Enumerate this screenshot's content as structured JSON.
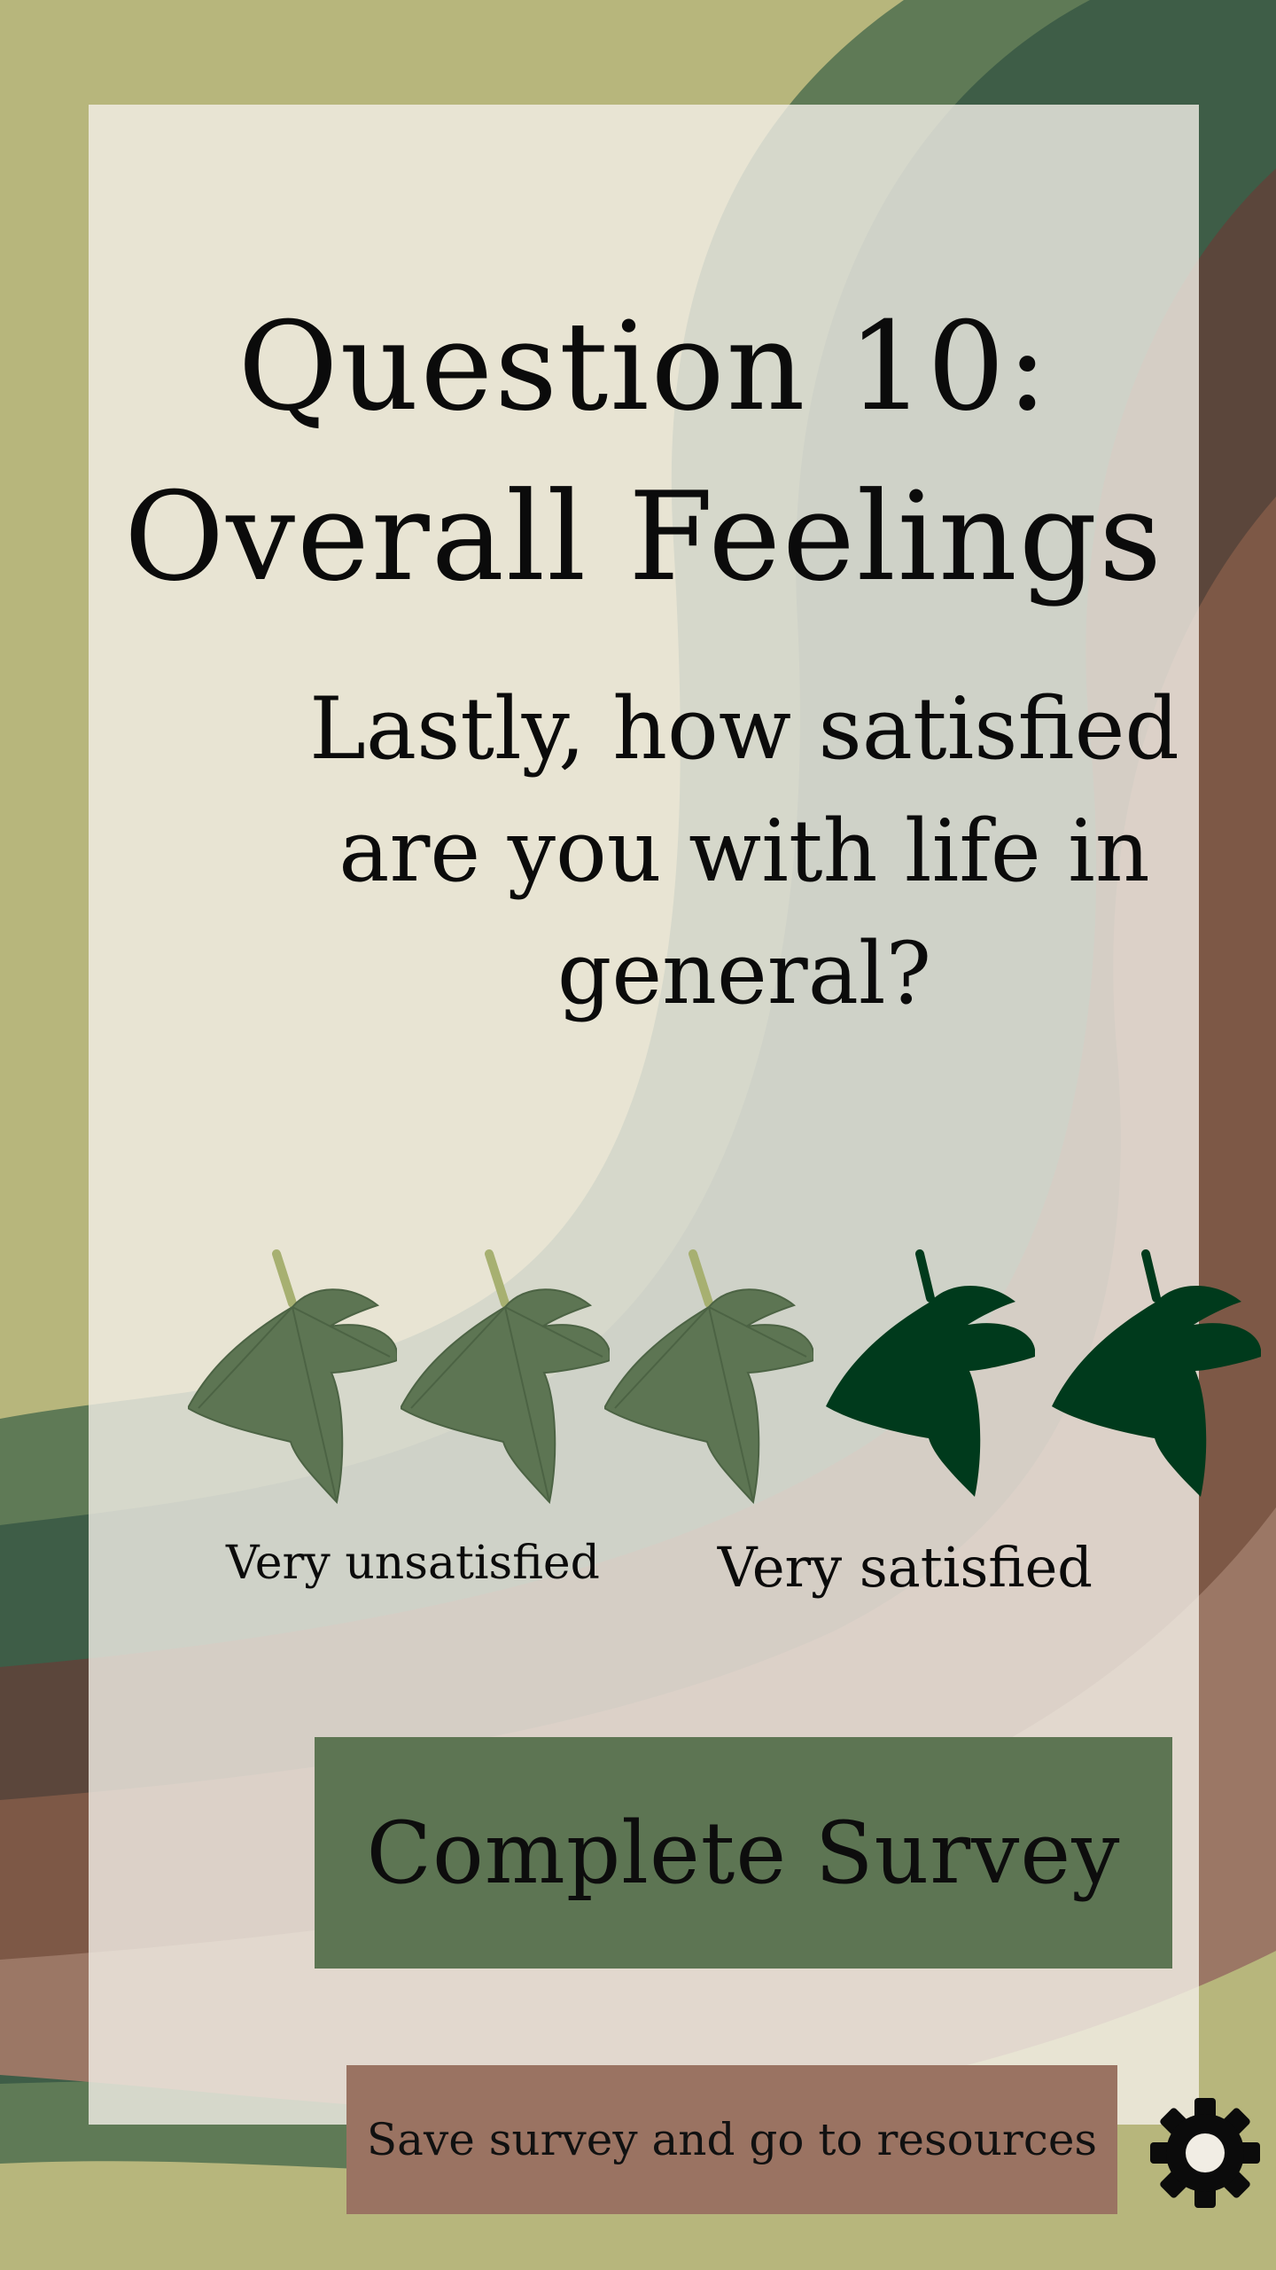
{
  "screen": {
    "title": "Question 10:\nOverall Feelings",
    "question": "Lastly, how satisfied are you with life in general?"
  },
  "rating": {
    "max": 5,
    "selected": 3,
    "icon": "leaf-icon",
    "min_label": "Very unsatisfied",
    "max_label": "Very satisfied"
  },
  "actions": {
    "complete_label": "Complete Survey",
    "resources_label": "Save survey and go to resources",
    "settings_icon": "gear-icon"
  },
  "colors": {
    "background_olive": "#b7b67c",
    "selected_leaf": "#5d7553",
    "unselected_leaf": "#003a1c",
    "leaf_stem": "#a7b071",
    "complete_button": "#5d7553",
    "resources_button": "#9a7362",
    "card": "#f4f0e8"
  }
}
